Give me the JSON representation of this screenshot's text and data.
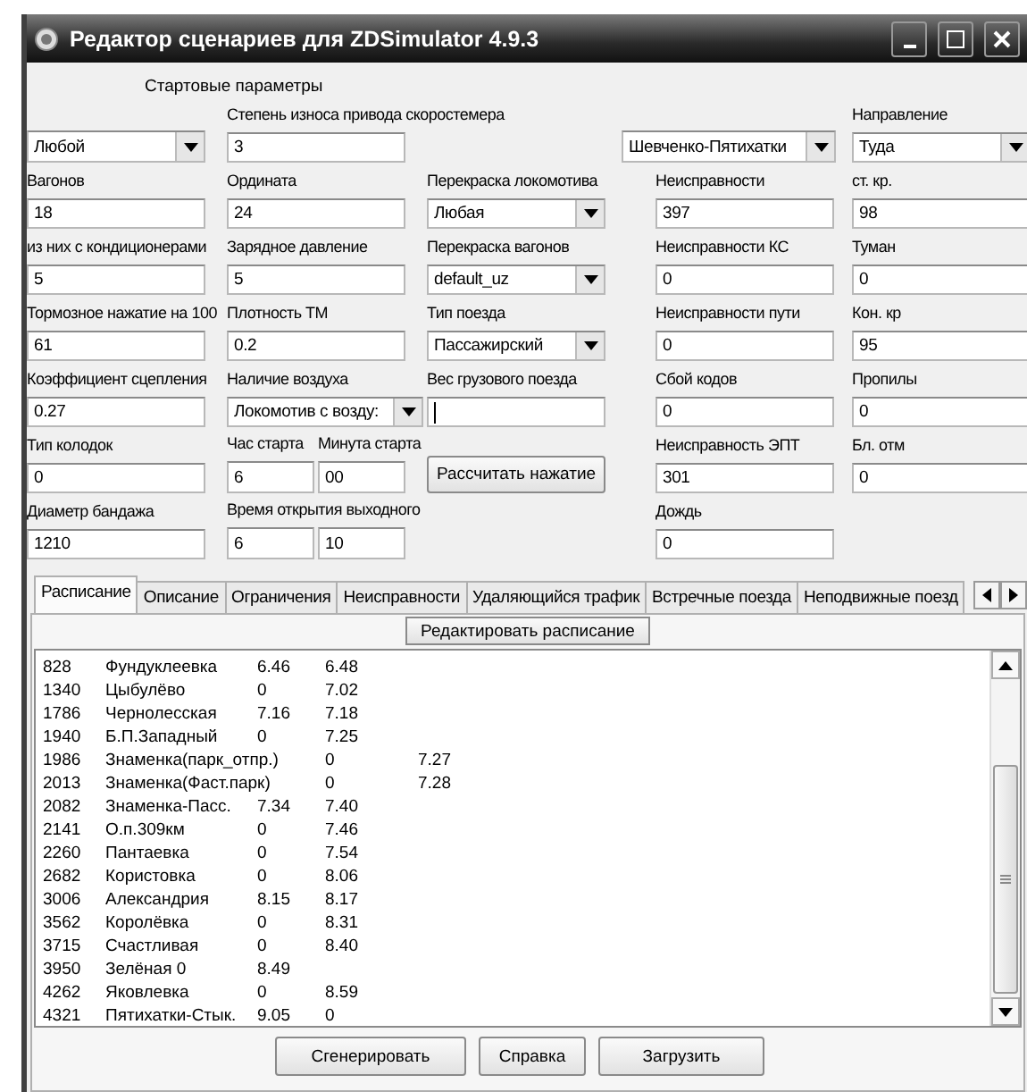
{
  "window": {
    "title": "Редактор сценариев для ZDSimulator 4.9.3"
  },
  "form": {
    "heading": "Стартовые параметры",
    "rows": [
      [
        {
          "kind": "select",
          "value": "Любой"
        },
        {
          "kind": "text",
          "label": "Степень износа привода скоростемера",
          "value": "3"
        },
        {
          "kind": "empty"
        },
        {
          "kind": "select",
          "value": "Шевченко-Пятихатки"
        },
        {
          "kind": "select",
          "label": "Направление",
          "value": "Туда"
        }
      ],
      [
        {
          "kind": "text",
          "label": "Вагонов",
          "value": "18"
        },
        {
          "kind": "text",
          "label": "Ордината",
          "value": "24"
        },
        {
          "kind": "select",
          "label": "Перекраска локомотива",
          "value": "Любая"
        },
        {
          "kind": "text",
          "label": "Неисправности",
          "value": "397"
        },
        {
          "kind": "text",
          "label": "ст. кр.",
          "value": "98"
        }
      ],
      [
        {
          "kind": "text",
          "label": "из них с кондиционерами",
          "value": "5"
        },
        {
          "kind": "text",
          "label": "Зарядное давление",
          "value": "5"
        },
        {
          "kind": "select",
          "label": "Перекраска вагонов",
          "value": "default_uz"
        },
        {
          "kind": "text",
          "label": "Неисправности КС",
          "value": "0"
        },
        {
          "kind": "text",
          "label": "Туман",
          "value": "0"
        }
      ],
      [
        {
          "kind": "text",
          "label": "Тормозное нажатие на 100",
          "value": "61"
        },
        {
          "kind": "text",
          "label": "Плотность ТМ",
          "value": "0.2"
        },
        {
          "kind": "select",
          "label": "Тип поезда",
          "value": "Пассажирский"
        },
        {
          "kind": "text",
          "label": "Неисправности пути",
          "value": "0"
        },
        {
          "kind": "text",
          "label": "Кон. кр",
          "value": "95"
        }
      ],
      [
        {
          "kind": "text",
          "label": "Коэффициент сцепления",
          "value": "0.27"
        },
        {
          "kind": "select",
          "label": "Наличие воздуха",
          "value": "Локомотив с возду:"
        },
        {
          "kind": "text",
          "label": "Вес грузового поезда",
          "focused": true
        },
        {
          "kind": "text",
          "label": "Сбой кодов",
          "value": "0"
        },
        {
          "kind": "text",
          "label": "Пропилы",
          "value": "0"
        }
      ],
      [
        {
          "kind": "text",
          "label": "Тип колодок",
          "value": "0"
        },
        {
          "kind": "split",
          "parts": [
            {
              "label": "Час старта",
              "value": "6"
            },
            {
              "label": "Минута старта",
              "value": "00"
            }
          ]
        },
        {
          "kind": "button",
          "label": "Рассчитать нажатие"
        },
        {
          "kind": "text",
          "label": "Неисправность ЭПТ",
          "value": "301"
        },
        {
          "kind": "text",
          "label": "Бл. отм",
          "value": "0"
        }
      ],
      [
        {
          "kind": "text",
          "label": "Диаметр бандажа",
          "value": "1210"
        },
        {
          "kind": "split",
          "label": "Время открытия выходного",
          "parts": [
            {
              "value": "6"
            },
            {
              "value": "10"
            }
          ]
        },
        {
          "kind": "empty"
        },
        {
          "kind": "text",
          "label": "Дождь",
          "value": "0"
        },
        {
          "kind": "empty"
        }
      ]
    ]
  },
  "tabs": [
    {
      "label": "Расписание",
      "selected": true
    },
    {
      "label": "Описание",
      "selected": false
    },
    {
      "label": "Ограничения",
      "selected": false
    },
    {
      "label": "Неисправности",
      "selected": false
    },
    {
      "label": "Удаляющийся трафик",
      "selected": false
    },
    {
      "label": "Встречные поезда",
      "selected": false
    },
    {
      "label": "Неподвижные поезд",
      "selected": false
    }
  ],
  "edit_button": "Редактировать расписание",
  "schedule": [
    {
      "cells": [
        "828",
        "Фундуклеевка",
        "6.46",
        "6.48"
      ]
    },
    {
      "cells": [
        "1340",
        "Цыбулёво",
        "0",
        "7.02"
      ]
    },
    {
      "cells": [
        "1786",
        "Чернолесская",
        "7.16",
        "7.18"
      ]
    },
    {
      "cells": [
        "1940",
        "Б.П.Западный",
        "0",
        "7.25"
      ]
    },
    {
      "cells": [
        "1986",
        "Знаменка(парк_отпр.)",
        "0",
        "7.27"
      ],
      "long_name": true
    },
    {
      "cells": [
        "2013",
        "Знаменка(Фаст.парк)",
        "0",
        "7.28"
      ],
      "long_name": true
    },
    {
      "cells": [
        "2082",
        "Знаменка-Пасс.",
        "7.34",
        "7.40"
      ]
    },
    {
      "cells": [
        "2141",
        "О.п.309км",
        "0",
        "7.46"
      ]
    },
    {
      "cells": [
        "2260",
        "Пантаевка",
        "0",
        "7.54"
      ]
    },
    {
      "cells": [
        "2682",
        "Користовка",
        "0",
        "8.06"
      ]
    },
    {
      "cells": [
        "3006",
        "Александрия",
        "8.15",
        "8.17"
      ]
    },
    {
      "cells": [
        "3562",
        "Королёвка",
        "0",
        "8.31"
      ]
    },
    {
      "cells": [
        "3715",
        "Счастливая",
        "0",
        "8.40"
      ]
    },
    {
      "cells": [
        "3950",
        "Зелёная 0",
        "8.49"
      ]
    },
    {
      "cells": [
        "4262",
        "Яковлевка",
        "0",
        "8.59"
      ]
    },
    {
      "cells": [
        "4321",
        "Пятихатки-Стык.",
        "9.05",
        "0"
      ]
    }
  ],
  "buttons": [
    "Сгенерировать",
    "Справка",
    "Загрузить"
  ]
}
